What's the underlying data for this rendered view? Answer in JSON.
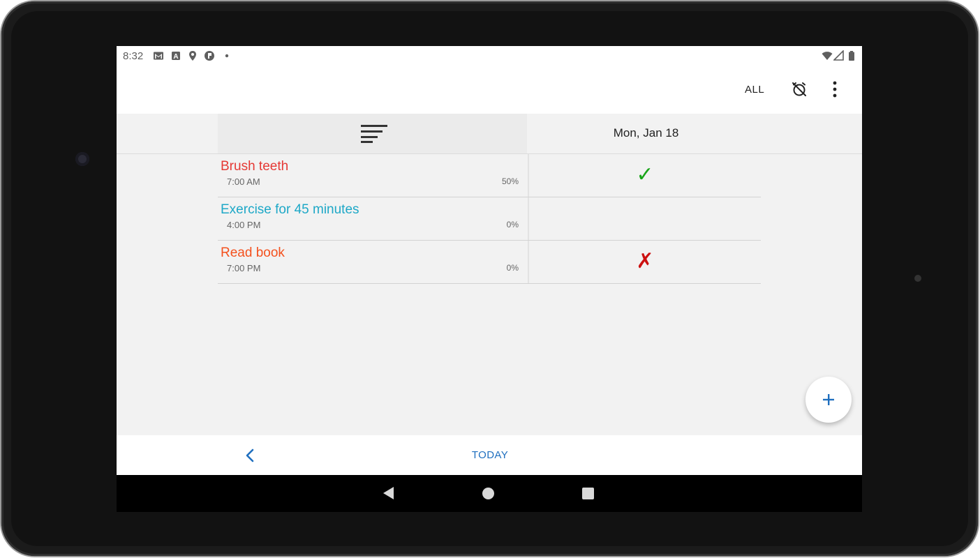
{
  "status_bar": {
    "time": "8:32",
    "left_icons": [
      "gmail-icon",
      "a-notification-icon",
      "location-pin-icon",
      "app-notification-icon",
      "dot-icon"
    ],
    "right_icons": [
      "wifi-icon",
      "signal-icon",
      "battery-icon"
    ]
  },
  "app_bar": {
    "filter_label": "ALL",
    "alarm_icon": "alarm-off-icon",
    "more_icon": "more-vert-icon"
  },
  "header": {
    "sort_icon": "sort-icon",
    "date_label": "Mon, Jan 18"
  },
  "habits": [
    {
      "name": "Brush teeth",
      "time": "7:00 AM",
      "percent": "50%",
      "mark": "✓",
      "name_color": "#e53935",
      "mark_color": "#1aa51a"
    },
    {
      "name": "Exercise for 45 minutes",
      "time": "4:00 PM",
      "percent": "0%",
      "mark": "",
      "name_color": "#1ea8c7",
      "mark_color": "#000000"
    },
    {
      "name": "Read book",
      "time": "7:00 PM",
      "percent": "0%",
      "mark": "✗",
      "name_color": "#f4511e",
      "mark_color": "#cc1111"
    }
  ],
  "fab": {
    "icon": "add-icon"
  },
  "bottom_bar": {
    "prev_icon": "chevron-left-icon",
    "today_label": "TODAY"
  },
  "nav_bar": {
    "icons": [
      "back-triangle-icon",
      "home-circle-icon",
      "recents-square-icon"
    ]
  },
  "colors": {
    "accent": "#1f6fbf",
    "background": "#f2f2f2"
  }
}
